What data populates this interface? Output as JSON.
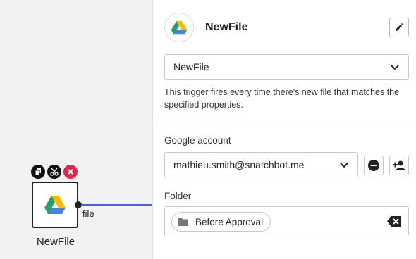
{
  "canvas": {
    "node": {
      "label": "NewFile",
      "port_label": "file",
      "actions": [
        "copy-icon",
        "cut-icon",
        "delete-icon"
      ],
      "icon": "google-drive-icon"
    }
  },
  "panel": {
    "title": "NewFile",
    "logo_icon": "google-drive-icon",
    "edit_icon": "pencil-icon",
    "trigger_select": {
      "value": "NewFile",
      "icon": "chevron-down-icon"
    },
    "description": "This trigger fires every time there's new file that matches the specified properties.",
    "google_account": {
      "label": "Google account",
      "value": "mathieu.smith@snatchbot.me",
      "remove_icon": "minus-circle-icon",
      "add_icon": "add-user-icon"
    },
    "folder": {
      "label": "Folder",
      "chip_label": "Before Approval",
      "chip_icon": "folder-icon",
      "clear_icon": "backspace-icon"
    }
  },
  "colors": {
    "canvas_bg": "#f2f2f2",
    "connector": "#4a5ee8",
    "delete_action": "#e5244a",
    "drive_green": "#1ea362",
    "drive_yellow": "#ffba00",
    "drive_blue": "#4a7fe8"
  }
}
